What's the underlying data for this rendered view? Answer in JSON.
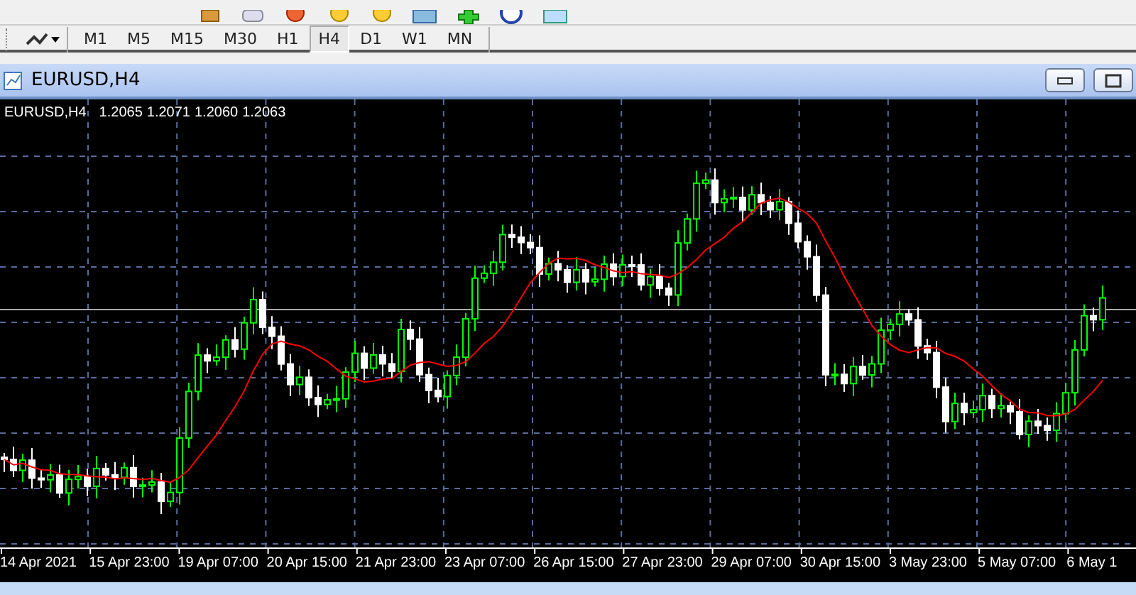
{
  "toolbar": {
    "timeframes": [
      {
        "label": "M1",
        "selected": false
      },
      {
        "label": "M5",
        "selected": false
      },
      {
        "label": "M15",
        "selected": false
      },
      {
        "label": "M30",
        "selected": false
      },
      {
        "label": "H1",
        "selected": false
      },
      {
        "label": "H4",
        "selected": true
      },
      {
        "label": "D1",
        "selected": false
      },
      {
        "label": "W1",
        "selected": false
      },
      {
        "label": "MN",
        "selected": false
      }
    ]
  },
  "window": {
    "title": "EURUSD,H4"
  },
  "chart": {
    "symbol": "EURUSD,H4",
    "prices": [
      "1.2065",
      "1.2071",
      "1.2060",
      "1.2063"
    ],
    "time_labels": [
      "14 Apr 2021",
      "15 Apr 23:00",
      "19 Apr 07:00",
      "20 Apr 15:00",
      "21 Apr 23:00",
      "23 Apr 07:00",
      "26 Apr 15:00",
      "27 Apr 23:00",
      "29 Apr 07:00",
      "30 Apr 15:00",
      "3 May 23:00",
      "5 May 07:00",
      "6 May 1"
    ]
  }
}
